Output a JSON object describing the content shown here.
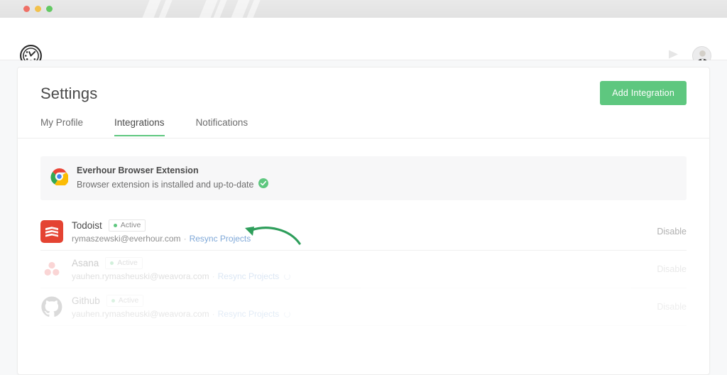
{
  "window": {
    "traffic_lights": [
      "close",
      "minimize",
      "maximize"
    ]
  },
  "header": {
    "brand_icon": "everhour-timer-logo",
    "play_icon": "play-icon",
    "avatar_icon": "user-avatar"
  },
  "card": {
    "title": "Settings",
    "add_integration_label": "Add Integration"
  },
  "tabs": [
    {
      "label": "My Profile",
      "active": false
    },
    {
      "label": "Integrations",
      "active": true
    },
    {
      "label": "Notifications",
      "active": false
    }
  ],
  "extension_banner": {
    "icon": "chrome-icon",
    "title": "Everhour Browser Extension",
    "subtitle": "Browser extension is installed and up-to-date",
    "status_icon": "check-circle-icon"
  },
  "integrations": [
    {
      "icon": "todoist-icon",
      "name": "Todoist",
      "status": "Active",
      "account": "rymaszewski@everhour.com",
      "separator": "·",
      "resync_label": "Resync Projects",
      "disable_label": "Disable",
      "syncing": false
    },
    {
      "icon": "asana-icon",
      "name": "Asana",
      "status": "Active",
      "account": "yauhen.rymasheuski@weavora.com",
      "separator": "·",
      "resync_label": "Resync Projects",
      "disable_label": "Disable",
      "syncing": true
    },
    {
      "icon": "github-icon",
      "name": "Github",
      "status": "Active",
      "account": "yauhen.rymasheuski@weavora.com",
      "separator": "·",
      "resync_label": "Resync Projects",
      "disable_label": "Disable",
      "syncing": true
    }
  ],
  "annotation": {
    "arrow_icon": "curved-arrow-left-icon",
    "color": "#2e9e5b"
  },
  "colors": {
    "accent_green": "#5ec77f",
    "link_blue": "#7fa8d8",
    "text_dark": "#4a4a4a",
    "text_muted": "#8e8e8e",
    "page_bg": "#f7f8f9"
  }
}
